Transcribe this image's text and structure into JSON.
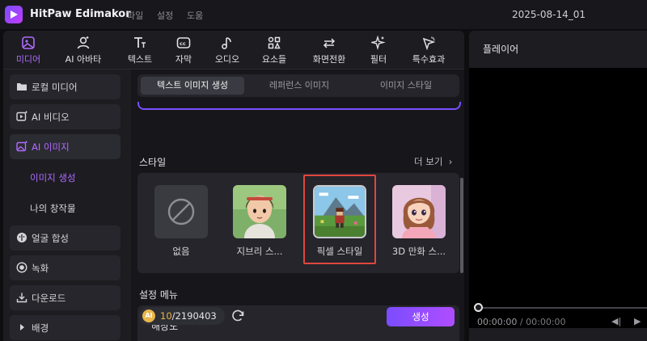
{
  "app": {
    "title": "HitPaw Edimakor",
    "menu": [
      "파일",
      "설정",
      "도움"
    ],
    "document_title": "2025-08-14_01"
  },
  "toolbar": {
    "items": [
      {
        "label": "미디어",
        "icon": "media-icon",
        "active": true
      },
      {
        "label": "AI 아바타",
        "icon": "avatar-icon",
        "active": false
      },
      {
        "label": "텍스트",
        "icon": "text-icon",
        "active": false
      },
      {
        "label": "자막",
        "icon": "caption-icon",
        "active": false
      },
      {
        "label": "오디오",
        "icon": "music-icon",
        "active": false
      },
      {
        "label": "요소들",
        "icon": "elements-icon",
        "active": false
      },
      {
        "label": "화면전환",
        "icon": "transition-icon",
        "active": false
      },
      {
        "label": "필터",
        "icon": "filter-icon",
        "active": false
      },
      {
        "label": "특수효과",
        "icon": "effects-icon",
        "active": false
      }
    ]
  },
  "sidebar": {
    "items": [
      {
        "label": "로컬 미디어",
        "icon": "folder-icon"
      },
      {
        "label": "AI 비디오",
        "icon": "ai-video-icon"
      },
      {
        "label": "AI 이미지",
        "icon": "ai-image-icon",
        "selected": true
      },
      {
        "label": "얼굴 합성",
        "icon": "face-swap-icon"
      },
      {
        "label": "녹화",
        "icon": "record-icon"
      },
      {
        "label": "다운로드",
        "icon": "download-icon"
      },
      {
        "label": "배경",
        "icon": "caret-right-icon"
      }
    ],
    "sub_items": [
      {
        "label": "이미지 생성",
        "active": true
      },
      {
        "label": "나의 창작물",
        "active": false
      }
    ]
  },
  "content": {
    "tabs": [
      {
        "label": "텍스트 이미지 생성",
        "active": true
      },
      {
        "label": "레퍼런스 이미지",
        "active": false
      },
      {
        "label": "이미지 스타일",
        "active": false
      }
    ],
    "style_section": {
      "title": "스타일",
      "more": "더 보기",
      "styles": [
        {
          "label": "없음",
          "icon": "none-icon"
        },
        {
          "label": "지브리 스...",
          "icon": "ghibli-style-thumbnail"
        },
        {
          "label": "픽셀 스타일",
          "icon": "pixel-style-thumbnail",
          "selected": true
        },
        {
          "label": "3D 만화 스...",
          "icon": "cartoon-3d-thumbnail"
        }
      ]
    },
    "settings": {
      "title": "설정 메뉴",
      "resolution_label": "해상도"
    },
    "footer": {
      "coin_label": "AI",
      "credits_used": "10",
      "credits_total": "/2190403",
      "generate": "생성"
    }
  },
  "player": {
    "title": "플레이어",
    "time_current": "00:00:00",
    "time_separator": "/",
    "time_total": "00:00:00"
  },
  "colors": {
    "accent": "#b06bff",
    "selection_border": "#e0463e",
    "background": "#0e0e11",
    "panel": "#1c1c21"
  }
}
